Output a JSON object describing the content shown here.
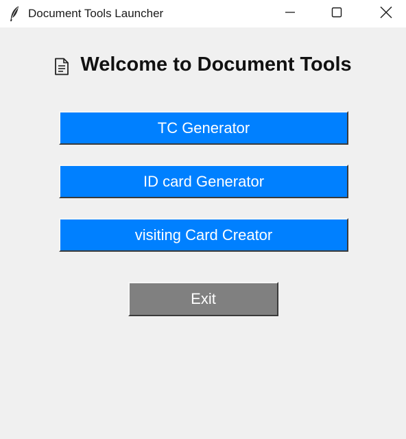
{
  "window": {
    "title": "Document Tools Launcher",
    "icons": {
      "app": "feather-icon",
      "minimize": "minimize-icon",
      "maximize": "maximize-icon",
      "close": "close-icon"
    }
  },
  "main": {
    "heading": "Welcome to Document Tools",
    "heading_icon": "document-icon",
    "buttons": {
      "tc_generator": "TC Generator",
      "id_card_generator": "ID card Generator",
      "visiting_card_creator": "visiting Card Creator",
      "exit": "Exit"
    }
  },
  "colors": {
    "background": "#f0f0f0",
    "titlebar": "#ffffff",
    "primary_button": "#0080ff",
    "exit_button": "#808080",
    "button_text": "#ffffff"
  }
}
